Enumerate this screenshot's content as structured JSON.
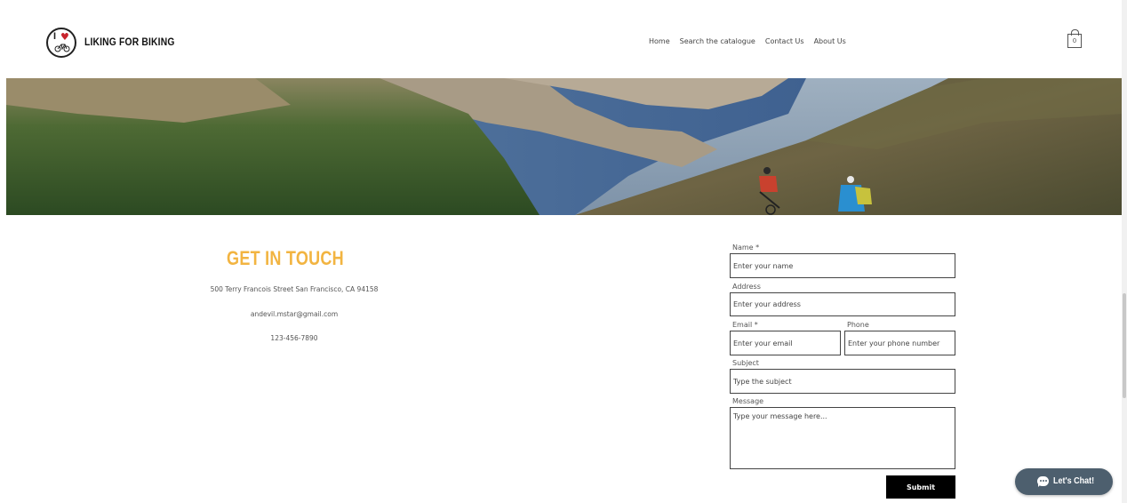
{
  "header": {
    "brand": "LIKING FOR BIKING",
    "logo_icon": "i-love-biking-logo-icon",
    "nav": [
      "Home",
      "Search the catalogue",
      "Contact Us",
      "About Us"
    ],
    "cart_count": "0",
    "cart_icon": "shopping-bag-icon"
  },
  "hero": {
    "image": "mountain-bikers-hero-image"
  },
  "contact": {
    "title": "GET IN TOUCH",
    "address": "500 Terry Francois Street San Francisco, CA 94158",
    "email": "andevil.mstar@gmail.com",
    "phone": "123-456-7890",
    "title_color": "#f2b441"
  },
  "form": {
    "name_label": "Name *",
    "name_placeholder": "Enter your name",
    "address_label": "Address",
    "address_placeholder": "Enter your address",
    "email_label": "Email *",
    "email_placeholder": "Enter your email",
    "phone_label": "Phone",
    "phone_placeholder": "Enter your phone number",
    "subject_label": "Subject",
    "subject_placeholder": "Type the subject",
    "message_label": "Message",
    "message_placeholder": "Type your message here...",
    "submit_label": "Submit"
  },
  "chat": {
    "label": "Let's Chat!",
    "icon": "chat-bubble-icon"
  }
}
